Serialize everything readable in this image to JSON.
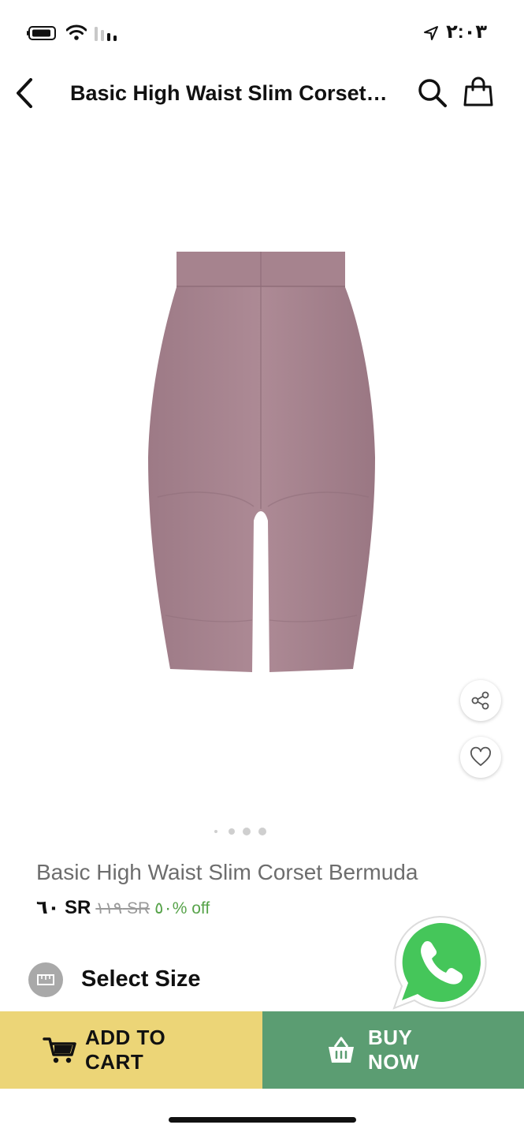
{
  "status_bar": {
    "time": "٢:٠٣"
  },
  "header": {
    "title": "Basic High Waist Slim Corset Bermuda"
  },
  "product": {
    "name": "Basic High Waist Slim Corset Bermuda",
    "price": "٦٠ SR",
    "old_price": "١١٩ SR",
    "discount": "٥٠% off",
    "image_color": "#a88590",
    "image_pager": {
      "count": 4,
      "active_index": 3
    }
  },
  "size": {
    "label": "Select Size"
  },
  "actions": {
    "add_to_cart": "ADD TO\nCART",
    "buy_now": "BUY\nNOW"
  },
  "colors": {
    "add_to_cart_bg": "#ecd577",
    "buy_now_bg": "#5b9d72",
    "discount": "#57a34a",
    "whatsapp": "#45c65a"
  }
}
